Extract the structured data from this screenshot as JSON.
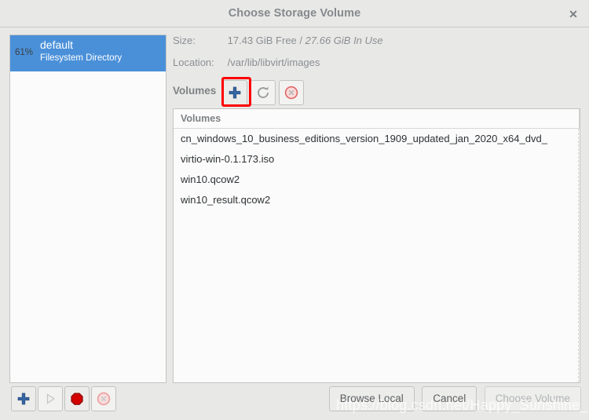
{
  "window": {
    "title": "Choose Storage Volume",
    "close_icon": "close-icon"
  },
  "pools": {
    "items": [
      {
        "percent": "61%",
        "name": "default",
        "type": "Filesystem Directory"
      }
    ]
  },
  "details": {
    "size_label": "Size:",
    "size_free": "17.43 GiB Free /",
    "size_in_use": "27.66 GiB In Use",
    "location_label": "Location:",
    "location_value": "/var/lib/libvirt/images"
  },
  "volumes_toolbar": {
    "caption": "Volumes",
    "add_icon": "plus-icon",
    "refresh_icon": "refresh-icon",
    "delete_icon": "delete-circle-icon"
  },
  "volumes_list": {
    "column_header": "Volumes",
    "items": [
      "cn_windows_10_business_editions_version_1909_updated_jan_2020_x64_dvd_",
      "virtio-win-0.1.173.iso",
      "win10.qcow2",
      "win10_result.qcow2"
    ]
  },
  "pool_actions": {
    "add_icon": "plus-icon",
    "start_icon": "play-icon",
    "stop_icon": "stop-octagon-icon",
    "delete_icon": "delete-circle-icon"
  },
  "dialog_actions": {
    "browse_local": "Browse Local",
    "cancel": "Cancel",
    "choose_volume": "Choose Volume"
  },
  "watermark": {
    "text": "https://blog.csdn.net/Happy_Sunshine_Boy"
  },
  "colors": {
    "selection_blue": "#4a90d9",
    "accent_red": "#fe0000",
    "window_bg": "#e8e8e7"
  }
}
